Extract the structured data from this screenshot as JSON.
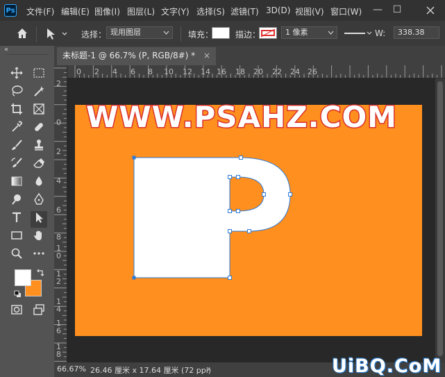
{
  "app": {
    "logo": "Ps"
  },
  "menu": [
    "文件(F)",
    "编辑(E)",
    "图像(I)",
    "图层(L)",
    "文字(Y)",
    "选择(S)",
    "滤镜(T)",
    "3D(D)",
    "视图(V)",
    "窗口(W)"
  ],
  "window_controls": {
    "minimize": "—",
    "maximize": "☐"
  },
  "options": {
    "select_label": "选择：",
    "select_value": "现用图层",
    "fill_label": "填充：",
    "stroke_label": "描边：",
    "stroke_width_value": "1 像素",
    "width_label": "W:",
    "width_value": "338.38"
  },
  "toolbar": {
    "collapse": "«"
  },
  "document": {
    "tab_title": "未标题-1 @ 66.7% (P, RGB/8#) *",
    "tab_close": "×"
  },
  "ruler_h": [
    "0",
    "2",
    "4",
    "6",
    "8",
    "10",
    "12",
    "14",
    "16",
    "18",
    "20",
    "22",
    "24",
    "26"
  ],
  "ruler_v": [
    "2",
    "0",
    "2",
    "4",
    "6",
    "8",
    "1\n0",
    "1\n2",
    "1\n4",
    "1\n6",
    "1\n8"
  ],
  "canvas": {
    "background": "#ff8f1e",
    "banner_text": "WWW.PSAHZ.COM",
    "letter_shape": "P"
  },
  "status": {
    "zoom": "66.67%",
    "doc_size": "26.46 厘米 x 17.64 厘米 (72 ppi)",
    "arrow": "›"
  },
  "watermark": "UiBQ.CoM",
  "colors": {
    "foreground": "#ffffff",
    "background": "#ff8f1e",
    "accent": "#31a8ff"
  }
}
